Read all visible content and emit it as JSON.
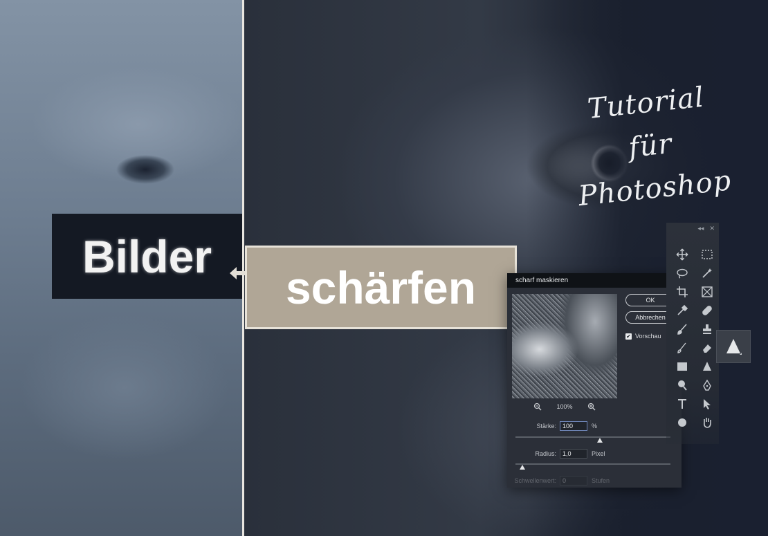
{
  "hero": {
    "title_left": "Bilder",
    "title_right": "schärfen",
    "script_line1": "Tutorial für",
    "script_line2": "Photoshop"
  },
  "dialog": {
    "title": "scharf maskieren",
    "close_glyph": "✕",
    "ok_label": "OK",
    "cancel_label": "Abbrechen",
    "preview_checkbox_label": "Vorschau",
    "preview_checked": true,
    "zoom_percent": "100%",
    "fields": {
      "amount_label": "Stärke:",
      "amount_value": "100",
      "amount_unit": "%",
      "radius_label": "Radius:",
      "radius_value": "1,0",
      "radius_unit": "Pixel",
      "threshold_label": "Schwellenwert:",
      "threshold_value": "0",
      "threshold_unit": "Stufen"
    }
  },
  "tools_panel": {
    "collapse_glyph": "◂◂",
    "close_glyph": "✕",
    "tools": [
      "move-icon",
      "marquee-icon",
      "lasso-icon",
      "magic-wand-icon",
      "crop-icon",
      "frame-icon",
      "eyedropper-icon",
      "healing-icon",
      "brush-icon",
      "stamp-icon",
      "history-brush-icon",
      "eraser-icon",
      "gradient-icon",
      "sharpen-icon",
      "dodge-icon",
      "pen-icon",
      "type-icon",
      "path-select-icon",
      "shape-icon",
      "hand-icon"
    ],
    "flyout_tool": "sharpen-icon"
  },
  "colors": {
    "dark_banner": "#141923",
    "beige_banner": "#b0a696",
    "dialog_bg": "#2b2f38",
    "accent_border": "#6f86b8"
  }
}
